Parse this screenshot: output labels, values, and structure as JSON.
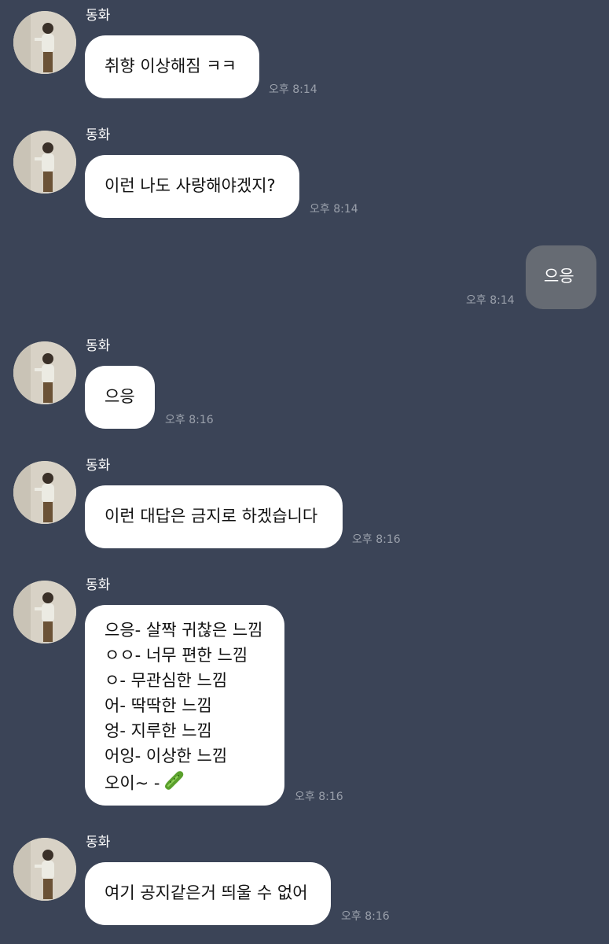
{
  "messages": [
    {
      "type": "received",
      "sender": "동화",
      "lines": [
        "취향 이상해짐 ㅋㅋ"
      ],
      "time": "오후 8:14"
    },
    {
      "type": "received",
      "sender": "동화",
      "lines": [
        "이런 나도 사랑해야겠지?"
      ],
      "time": "오후 8:14"
    },
    {
      "type": "sent",
      "lines": [
        "으응"
      ],
      "time": "오후 8:14"
    },
    {
      "type": "received",
      "sender": "동화",
      "lines": [
        "으응"
      ],
      "time": "오후 8:16"
    },
    {
      "type": "received",
      "sender": "동화",
      "lines": [
        "이런 대답은 금지로 하겠습니다"
      ],
      "time": "오후 8:16"
    },
    {
      "type": "received",
      "sender": "동화",
      "lines": [
        "으응- 살짝 귀찮은 느낌",
        "ㅇㅇ- 너무 편한 느낌",
        "ㅇ- 무관심한 느낌",
        "어- 딱딱한 느낌",
        "엉- 지루한 느낌",
        "어잉- 이상한 느낌",
        "오이~ -"
      ],
      "emoji": "cucumber-emoji",
      "time": "오후 8:16"
    },
    {
      "type": "received",
      "sender": "동화",
      "lines": [
        "여기 공지같은거 띄울 수 없어"
      ],
      "time": "오후 8:16"
    }
  ],
  "colors": {
    "background": "#3b4457",
    "received_bubble": "#ffffff",
    "sent_bubble": "#666b73",
    "timestamp": "#9aa0ab"
  }
}
